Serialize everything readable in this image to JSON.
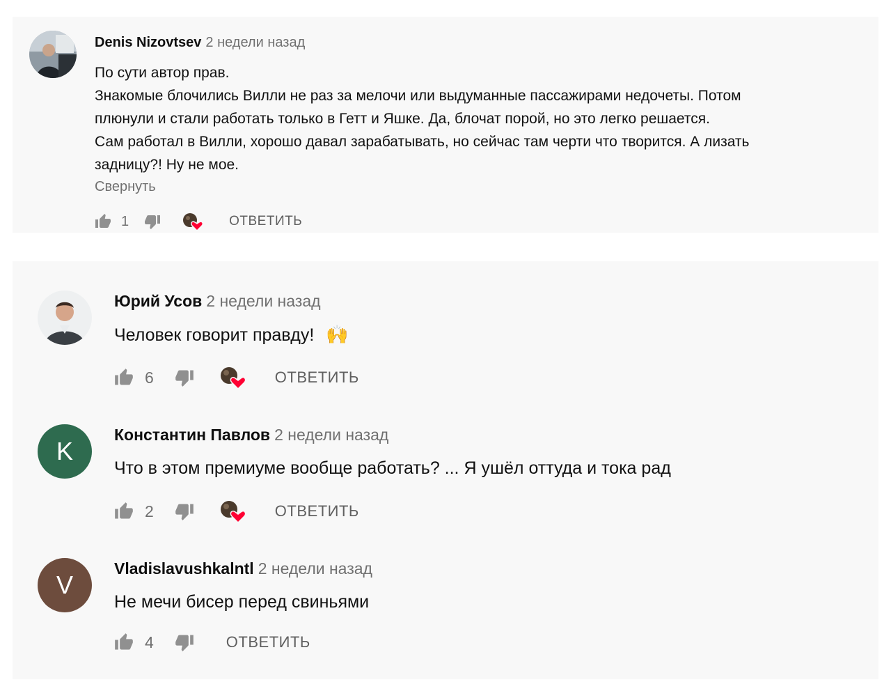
{
  "comments": [
    {
      "author": "Denis Nizovtsev",
      "time": "2 недели назад",
      "lines": [
        "По сути автор прав.",
        "Знакомые блочились Вилли не раз за мелочи или выдуманные пассажирами недочеты. Потом",
        "плюнули и стали работать только в  Гетт и Яшке. Да, блочат порой, но это легко решается.",
        "Сам работал в Вилли, хорошо давал зарабатывать, но сейчас там черти что творится. А лизать",
        "задницу?! Ну не мое."
      ],
      "collapse": "Свернуть",
      "likes": "1",
      "reply": "ОТВЕТИТЬ",
      "avatar": "photo-man-in-car"
    },
    {
      "author": "Юрий Усов",
      "time": "2 недели назад",
      "text": "Человек говорит правду!",
      "emoji": "🙌",
      "likes": "6",
      "reply": "ОТВЕТИТЬ",
      "avatar": "photo-man-portrait"
    },
    {
      "author": "Константин Павлов",
      "time": "2 недели назад",
      "text": "Что в этом премиуме вообще работать? ... Я ушёл оттуда и тока рад",
      "likes": "2",
      "reply": "ОТВЕТИТЬ",
      "avatar_letter": "K",
      "avatar_color": "#2e6b4f"
    },
    {
      "author": "Vladislavushkalntl",
      "time": "2 недели назад",
      "text": "Не мечи бисер перед свиньями",
      "likes": "4",
      "reply": "ОТВЕТИТЬ",
      "avatar_letter": "V",
      "avatar_color": "#6d4c3d"
    }
  ],
  "colors": {
    "panel_bg": "#f8f8f8",
    "secondary_text": "#707070",
    "heart": "#ff0033"
  },
  "icons": [
    "like-icon",
    "dislike-icon",
    "creator-heart-icon"
  ]
}
